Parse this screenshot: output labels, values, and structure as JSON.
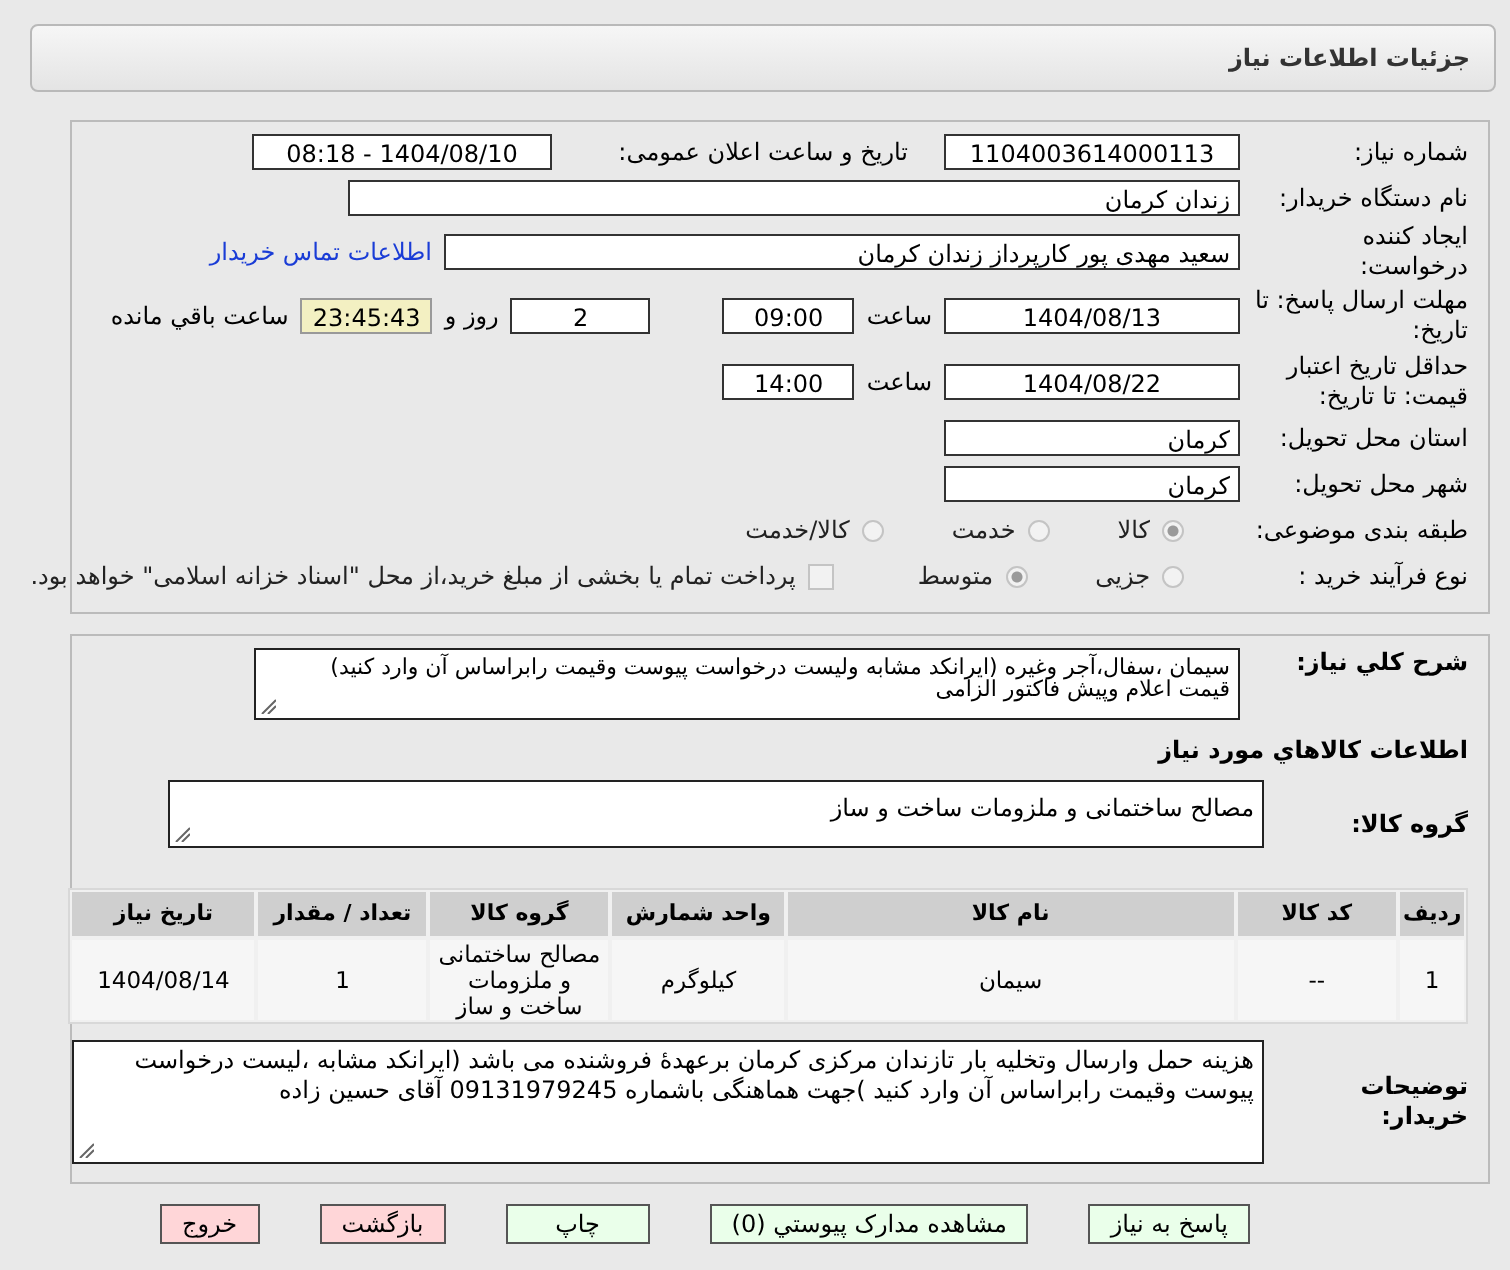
{
  "header": {
    "title": "جزئیات اطلاعات نیاز"
  },
  "need_number": {
    "label": "شماره نیاز:",
    "value": "1104003614000113"
  },
  "announce": {
    "label": "تاریخ و ساعت اعلان عمومی:",
    "value": "1404/08/10 - 08:18"
  },
  "buyer_org": {
    "label": "نام دستگاه خریدار:",
    "value": "زندان کرمان"
  },
  "requester": {
    "label": "ایجاد کننده درخواست:",
    "value": "سعید مهدی پور کارپرداز زندان کرمان",
    "link": "اطلاعات تماس خریدار"
  },
  "deadline": {
    "label": "مهلت ارسال پاسخ: تا تاریخ:",
    "date": "1404/08/13",
    "time_label": "ساعت",
    "time": "09:00",
    "days": "2",
    "days_label": "روز و",
    "remaining": "23:45:43",
    "remaining_label": "ساعت باقي مانده"
  },
  "validity": {
    "label": "حداقل تاریخ اعتبار قیمت: تا تاریخ:",
    "date": "1404/08/22",
    "time_label": "ساعت",
    "time": "14:00"
  },
  "province": {
    "label": "استان محل تحویل:",
    "value": "کرمان"
  },
  "city": {
    "label": "شهر محل تحویل:",
    "value": "کرمان"
  },
  "category": {
    "label": "طبقه بندی موضوعی:",
    "options": [
      {
        "label": "کالا",
        "selected": true
      },
      {
        "label": "خدمت",
        "selected": false
      },
      {
        "label": "کالا/خدمت",
        "selected": false
      }
    ]
  },
  "process": {
    "label": "نوع فرآیند خرید :",
    "options": [
      {
        "label": "جزیی",
        "selected": false
      },
      {
        "label": "متوسط",
        "selected": true
      }
    ],
    "payment": {
      "label": "پرداخت تمام یا بخشی از مبلغ خرید،از محل \"اسناد خزانه اسلامی\" خواهد بود.",
      "checked": false
    }
  },
  "description": {
    "label": "شرح کلي نياز:",
    "value": "سیمان ،سفال،آجر وغیره (ایرانکد مشابه ولیست درخواست پیوست وقیمت رابراساس آن وارد کنید) قیمت اعلام وپیش فاکتور الزامی"
  },
  "goods_title": "اطلاعات کالاهاي مورد نياز",
  "goods_group": {
    "label": "گروه کالا:",
    "value": "مصالح ساختمانی و ملزومات ساخت و ساز"
  },
  "table": {
    "columns": [
      "ردیف",
      "کد کالا",
      "نام کالا",
      "واحد شمارش",
      "گروه کالا",
      "تعداد / مقدار",
      "تاریخ نیاز"
    ],
    "rows": [
      [
        "1",
        "--",
        "سیمان",
        "کیلوگرم",
        "مصالح ساختمانی و ملزومات ساخت و ساز",
        "1",
        "1404/08/14"
      ]
    ]
  },
  "buyer_notes": {
    "label": "توضیحات خریدار:",
    "value": "هزینه حمل وارسال وتخلیه بار تازندان مرکزی کرمان برعهدهٔ فروشنده می باشد (ایرانکد مشابه ،لیست درخواست پیوست وقیمت رابراساس آن وارد کنید )جهت هماهنگی باشماره 09131979245 آقای حسین زاده"
  },
  "buttons": [
    {
      "label": "پاسخ به نیاز",
      "kind": "normal"
    },
    {
      "label": "مشاهده مدارک پیوستي (0)",
      "kind": "normal"
    },
    {
      "label": "چاپ",
      "kind": "normal"
    },
    {
      "label": "بازگشت",
      "kind": "danger"
    },
    {
      "label": "خروج",
      "kind": "danger"
    }
  ]
}
